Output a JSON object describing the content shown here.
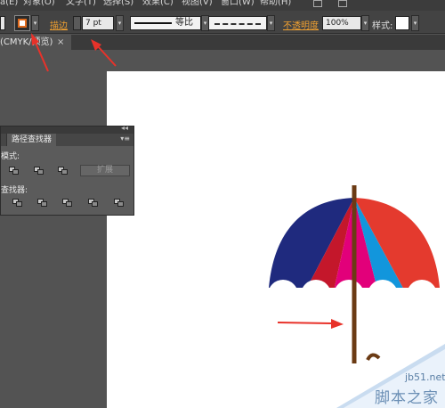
{
  "menubar": {
    "items": [
      "a(E)",
      "对象(O)",
      "文字(T)",
      "选择(S)",
      "效果(C)",
      "视图(V)",
      "窗口(W)",
      "帮助(H)"
    ]
  },
  "controlbar": {
    "stroke_label": "描边",
    "stroke_weight": "7 pt",
    "profile_label": "等比",
    "opacity_label": "不透明度",
    "opacity_value": "100%",
    "style_label": "样式:"
  },
  "document": {
    "tab_title": "(CMYK/预览)",
    "tab_close": "×"
  },
  "pathfinder": {
    "collapse_glyph": "◂◂",
    "tab_label": "路径查找器",
    "menu_glyph": "▾≡",
    "shape_modes_label": "模式:",
    "pathfinders_label": "查找器:",
    "expand_label": "扩展"
  },
  "watermark": {
    "url": "jb51.net",
    "name": "脚本之家"
  },
  "colors": {
    "annotation_arrow": "#e8322a",
    "umbrella_navy": "#1f2a7e",
    "umbrella_red": "#c4172b",
    "umbrella_magenta": "#e2007a",
    "umbrella_blue": "#1296dc",
    "umbrella_orange_red": "#e43a2e",
    "umbrella_handle": "#6b3b14",
    "stroke_swatch": "#e06a1c"
  }
}
